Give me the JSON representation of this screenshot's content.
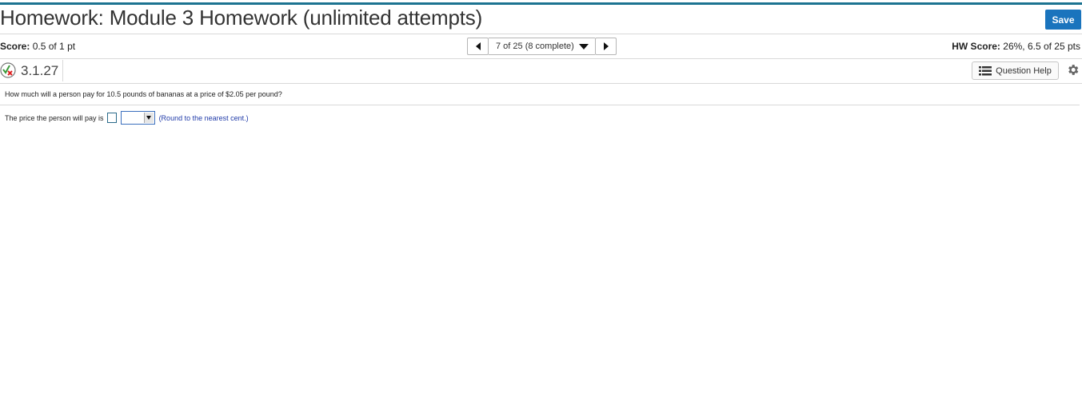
{
  "header": {
    "title": "Homework: Module 3 Homework (unlimited attempts)",
    "save_label": "Save"
  },
  "scorebar": {
    "score_label": "Score:",
    "score_value": "0.5 of 1 pt",
    "nav_text": "7 of 25 (8 complete)",
    "hw_label": "HW Score:",
    "hw_value": "26%, 6.5 of 25 pts"
  },
  "question_bar": {
    "number": "3.1.27",
    "help_label": "Question Help"
  },
  "question": {
    "prompt": "How much will a person pay for 10.5 pounds of bananas at a price of $2.05 per pound?",
    "answer_lead": "The price the person will pay is",
    "answer_value": "",
    "unit_selected": "",
    "hint": "(Round to the nearest cent.)"
  },
  "colors": {
    "accent": "#1c7391",
    "save_button": "#1a74bd",
    "hint_text": "#1f3aa8"
  }
}
